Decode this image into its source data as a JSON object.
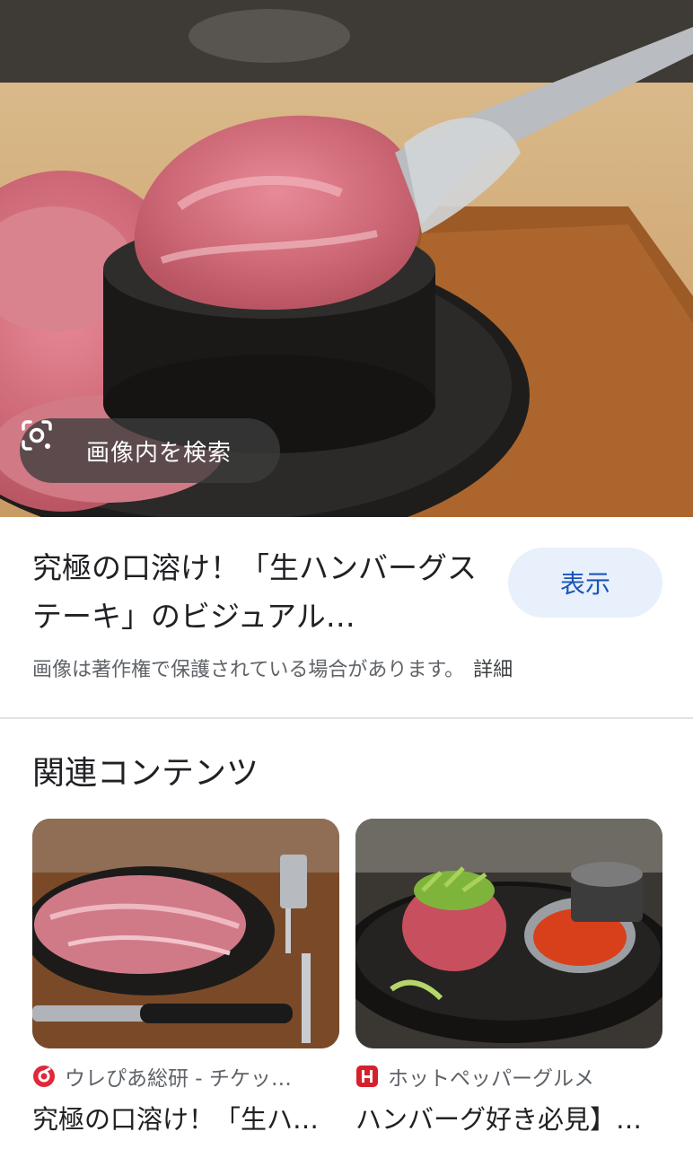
{
  "hero": {
    "lens_label": "画像内を検索"
  },
  "result": {
    "title": "究極の口溶け！「生ハンバーグステーキ」のビジュアル…",
    "view_label": "表示",
    "copyright_notice": "画像は著作権で保護されている場合があります。",
    "details_label": "詳細"
  },
  "related": {
    "heading": "関連コンテンツ",
    "cards": [
      {
        "source": "ウレぴあ総研 - チケッ…",
        "title": "究極の口溶け！「生ハ…",
        "favicon": "red-swirl-icon"
      },
      {
        "source": "ホットペッパーグルメ",
        "title": "ハンバーグ好き必見】…",
        "favicon": "hotpepper-icon"
      }
    ]
  },
  "colors": {
    "accent": "#1a56b8",
    "button_bg": "#e8f0fb",
    "muted_text": "#5f6368"
  }
}
